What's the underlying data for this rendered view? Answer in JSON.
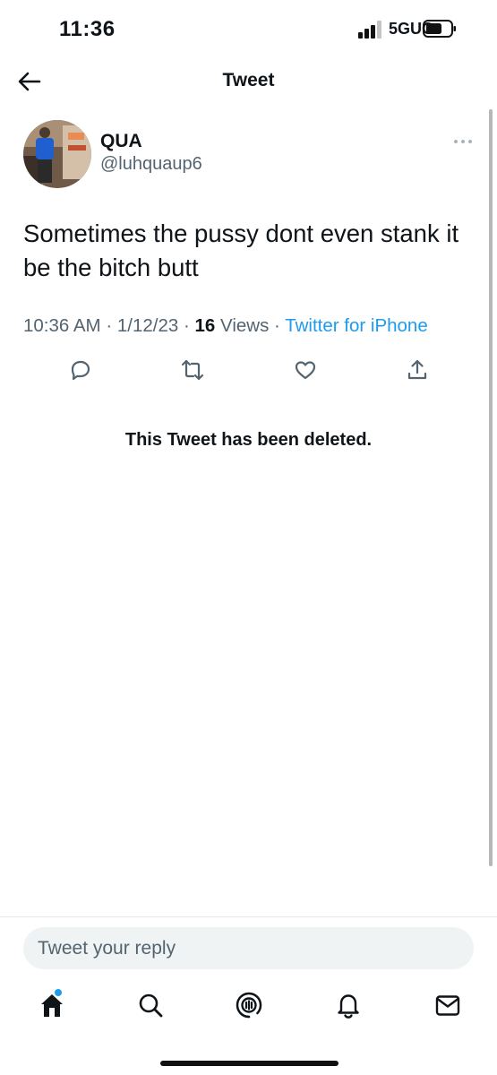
{
  "status_bar": {
    "time": "11:36",
    "network": "5GUC",
    "signal_icon": "cellular-signal-icon",
    "battery_icon": "battery-icon"
  },
  "header": {
    "title": "Tweet",
    "back_icon": "back-arrow-icon"
  },
  "tweet": {
    "display_name": "QUA",
    "handle": "@luhquaup6",
    "text": "Sometimes the pussy dont even stank it be the bitch butt",
    "time": "10:36 AM",
    "date": "1/12/23",
    "views_count": "16",
    "views_label": "Views",
    "source": "Twitter for iPhone",
    "more_icon": "more-options-icon",
    "actions": [
      "reply-icon",
      "retweet-icon",
      "like-icon",
      "share-icon"
    ]
  },
  "deleted_notice": "This Tweet has been deleted.",
  "reply": {
    "placeholder": "Tweet your reply"
  },
  "tab_bar": {
    "tabs": [
      "home-icon",
      "search-icon",
      "spaces-icon",
      "notifications-icon",
      "messages-icon"
    ]
  },
  "colors": {
    "accent": "#1d9bf0",
    "secondary_text": "#536471",
    "primary_text": "#0f1419"
  }
}
